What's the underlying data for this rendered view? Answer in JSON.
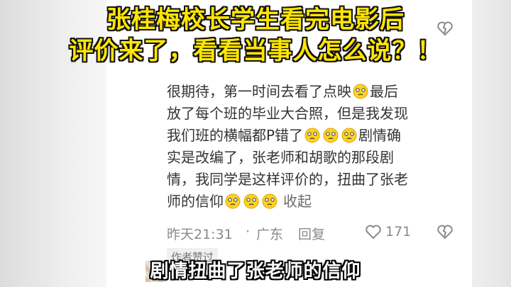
{
  "headline": {
    "line1": "张桂梅校长学生看完电影后",
    "line2": "评价来了，看看当事人怎么说？！"
  },
  "comment": {
    "lines": [
      "很期待，第一时间去看了点映",
      "最后",
      "放了每个班的毕业大合照，但是我发现",
      "我们班的横幅都P错了",
      "剧情确",
      "实是改编了，张老师和胡歌的那段剧",
      "情，我同学是这样评价的，扭曲了张老",
      "师的信仰"
    ],
    "collapse_label": "收起",
    "emoji_icon": "crying-face-icon",
    "time": "昨天21:31",
    "location": "广东",
    "reply_label": "回复",
    "like_count": "171",
    "author_liked_label": "作者赞过"
  },
  "subtitle": "剧情扭曲了张老师的信仰",
  "colors": {
    "headline": "#ffe600",
    "outline": "#111111",
    "comment_text": "#333333",
    "meta_text": "#8a8a8a"
  }
}
